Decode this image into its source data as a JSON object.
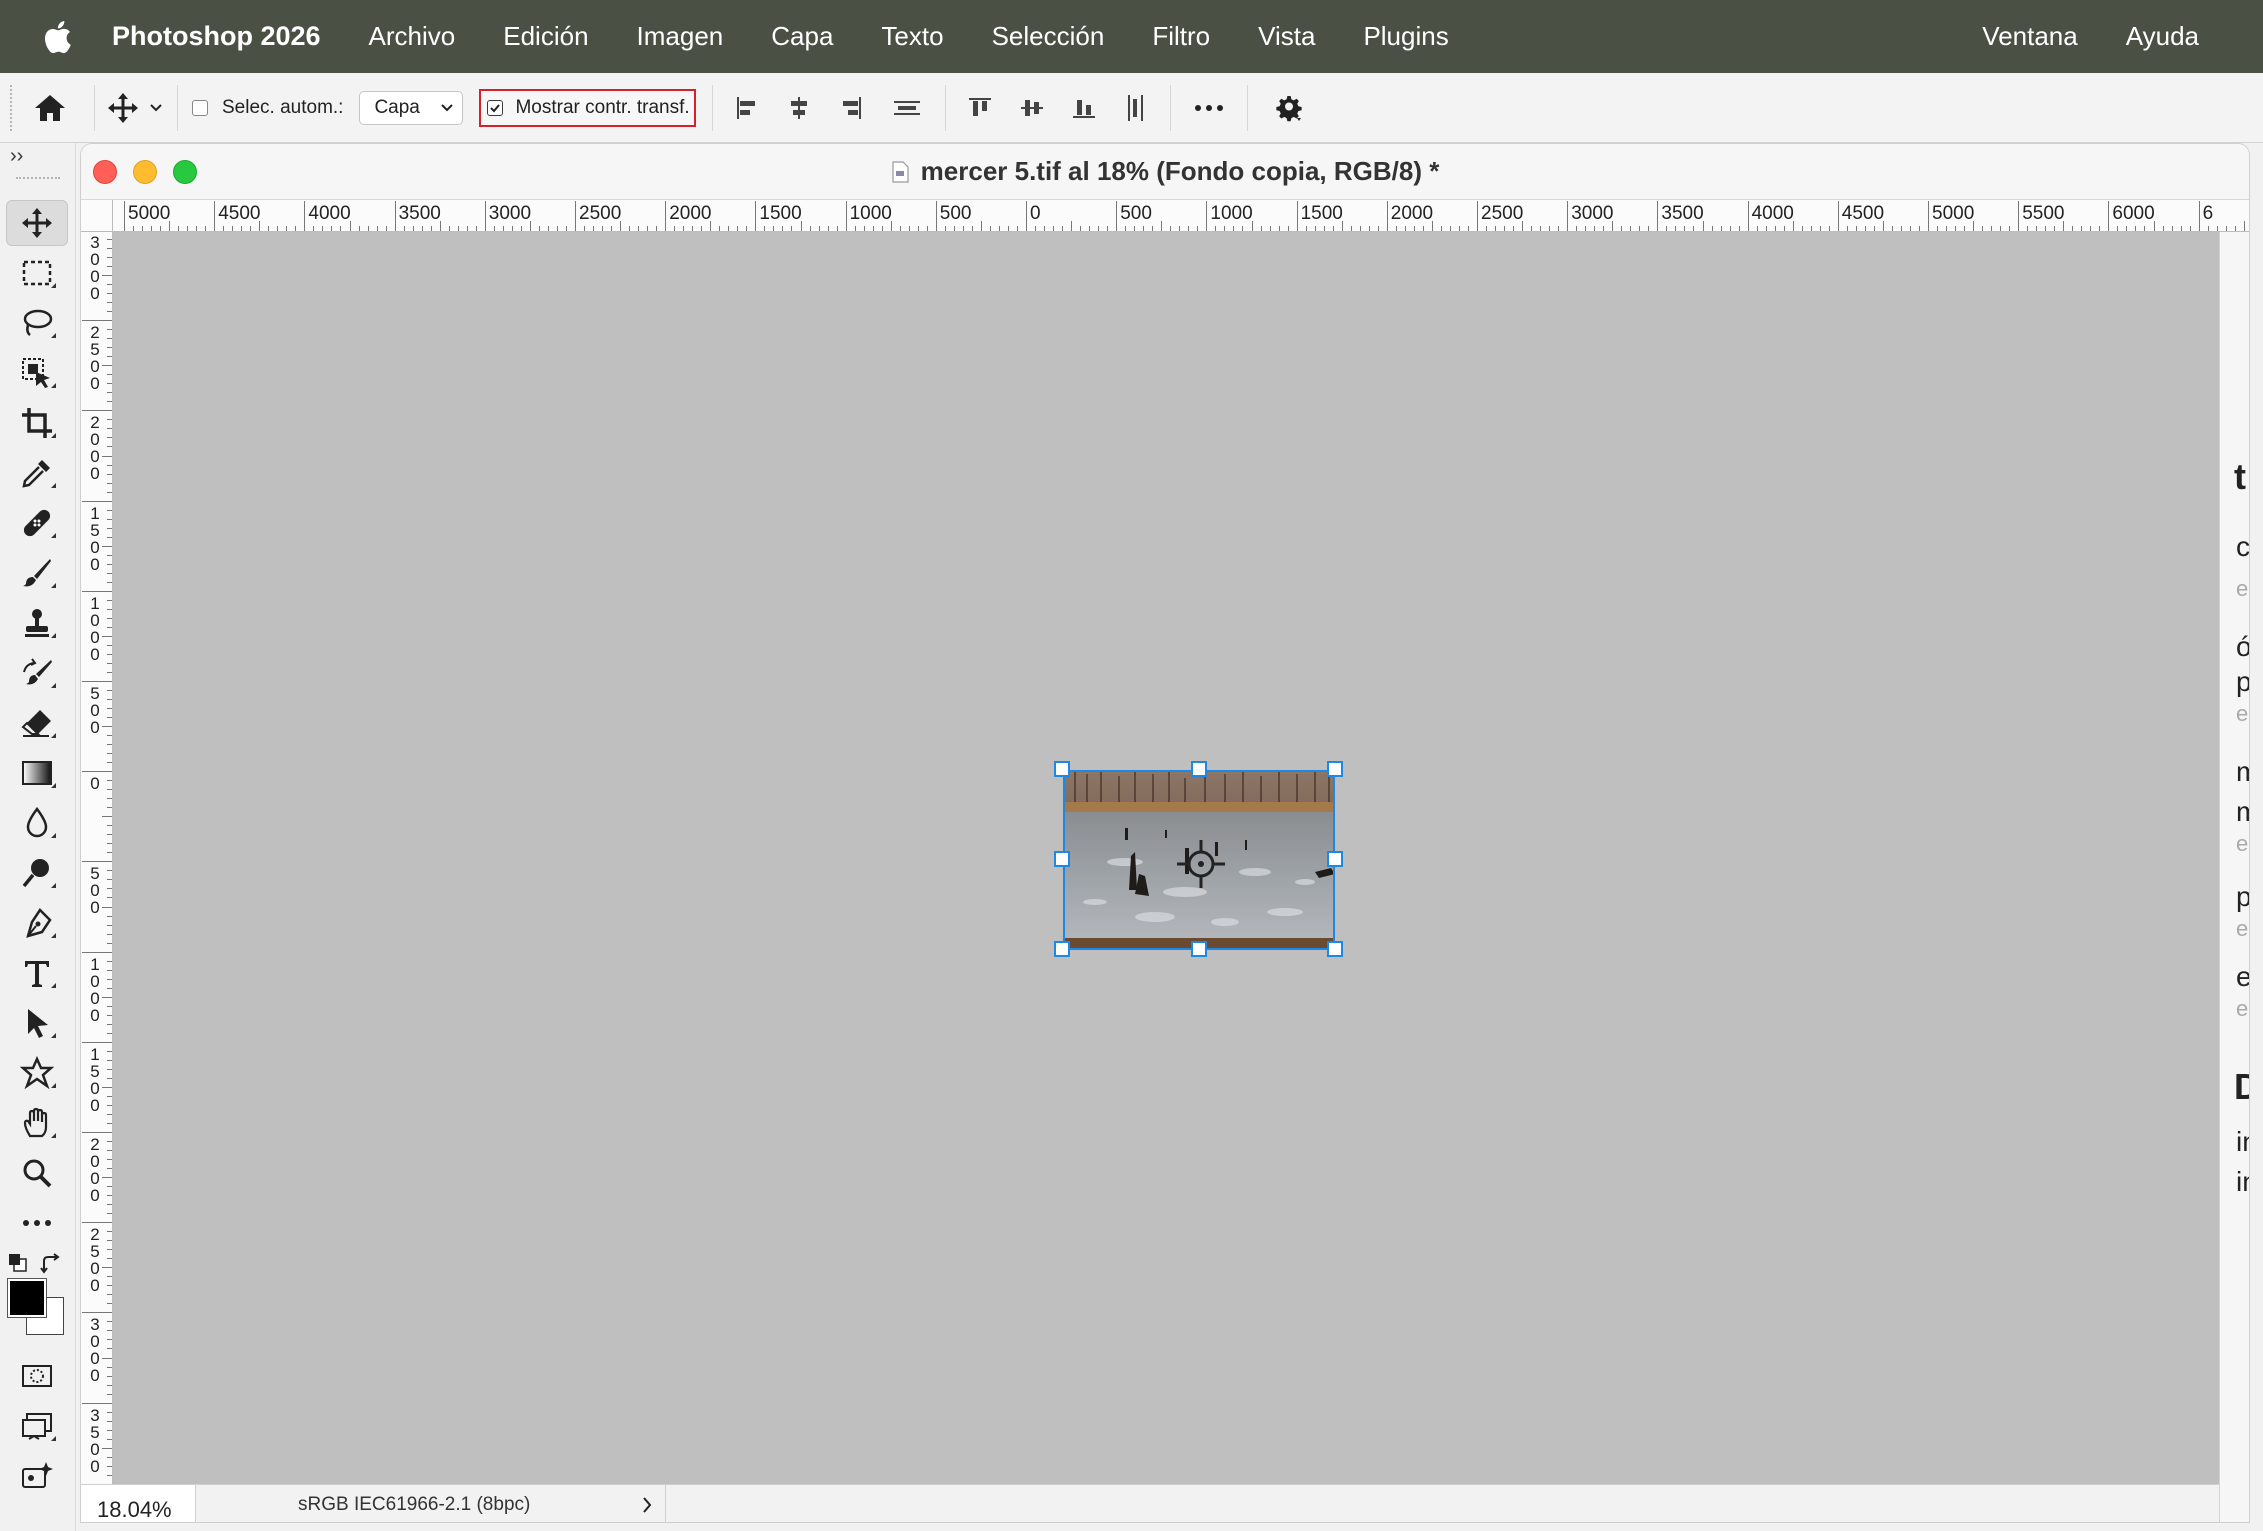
{
  "menubar": {
    "app_name": "Photoshop 2026",
    "items": [
      "Archivo",
      "Edición",
      "Imagen",
      "Capa",
      "Texto",
      "Selección",
      "Filtro",
      "Vista",
      "Plugins"
    ],
    "right_items": [
      "Ventana",
      "Ayuda"
    ]
  },
  "options": {
    "auto_select_label": "Selec. autom.:",
    "auto_select_checked": false,
    "layer_select_value": "Capa",
    "show_transform_label": "Mostrar contr. transf.",
    "show_transform_checked": true
  },
  "document": {
    "title": "mercer 5.tif al 18% (Fondo copia, RGB/8) *",
    "zoom": "18.04%",
    "color_profile": "sRGB IEC61966-2.1 (8bpc)"
  },
  "rulers": {
    "horizontal": [
      "5000",
      "4500",
      "4000",
      "3500",
      "3000",
      "2500",
      "2000",
      "1500",
      "1000",
      "500",
      "0",
      "500",
      "1000",
      "1500",
      "2000",
      "2500",
      "3000",
      "3500",
      "4000",
      "4500",
      "5000",
      "5500",
      "6000",
      "6"
    ],
    "vertical": [
      "3000",
      "2500",
      "2000",
      "1500",
      "1000",
      "500",
      "0",
      "500",
      "1000",
      "1500",
      "2000",
      "2500",
      "3000",
      "3500"
    ]
  },
  "right_panel_fragments": [
    "t",
    "c",
    "es",
    "ó",
    "p",
    "es",
    "m",
    "m",
    "e",
    "p",
    "es",
    "e",
    "es",
    "D",
    "in",
    "in"
  ],
  "tools": [
    "move-tool",
    "rectangular-marquee-tool",
    "lasso-tool",
    "object-selection-tool",
    "crop-tool",
    "eyedropper-tool",
    "spot-healing-tool",
    "brush-tool",
    "clone-stamp-tool",
    "history-brush-tool",
    "eraser-tool",
    "gradient-tool",
    "blur-tool",
    "dodge-tool",
    "pen-tool",
    "type-tool",
    "path-selection-tool",
    "custom-shape-tool",
    "hand-tool",
    "zoom-tool",
    "more-tools"
  ],
  "colors": {
    "menubar_bg": "#4b5045",
    "canvas_bg": "#bfbfbf",
    "selection_blue": "#1e88e5",
    "highlight_red": "#d8202c",
    "foreground": "#000000",
    "background": "#ffffff"
  }
}
